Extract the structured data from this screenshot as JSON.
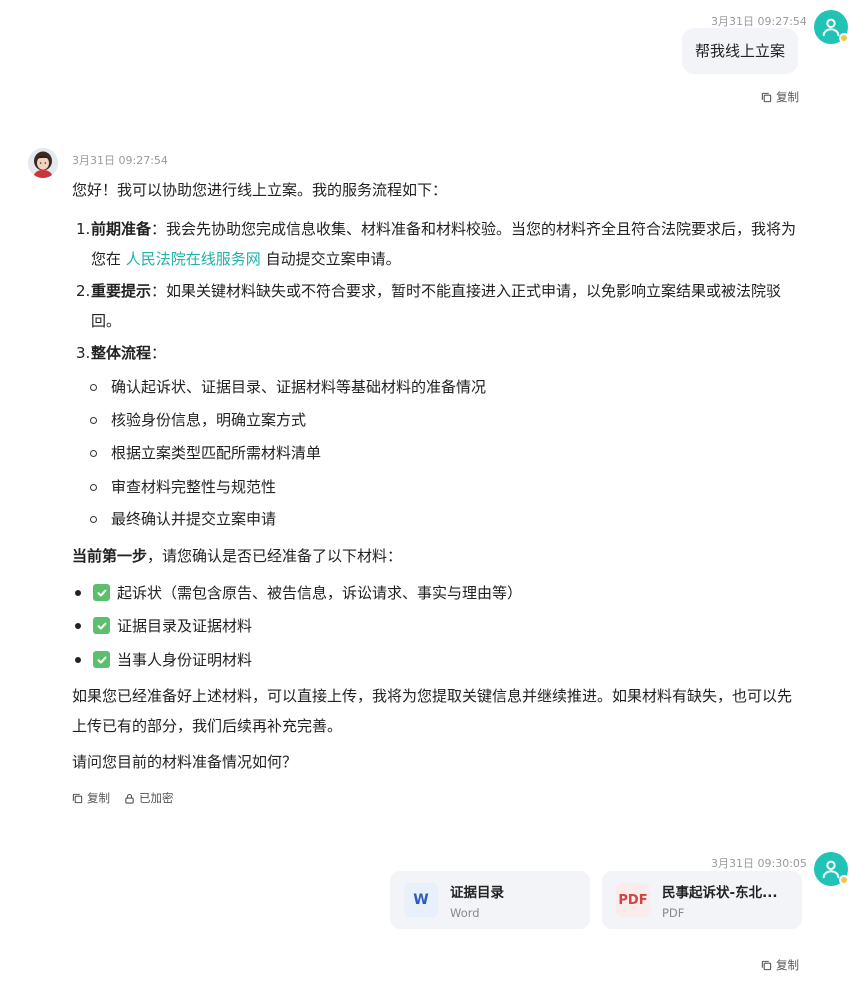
{
  "user_msg_1": {
    "timestamp": "3月31日 09:27:54",
    "text": "帮我线上立案",
    "copy_label": "复制"
  },
  "assistant": {
    "timestamp": "3月31日 09:27:54",
    "intro": "您好！我可以协助您进行线上立案。我的服务流程如下：",
    "items": [
      {
        "num": "1.",
        "title": "前期准备",
        "text_before_link": "：我会先协助您完成信息收集、材料准备和材料校验。当您的材料齐全且符合法院要求后，我将为您在 ",
        "link": "人民法院在线服务网",
        "text_after_link": " 自动提交立案申请。"
      },
      {
        "num": "2.",
        "title": "重要提示",
        "text": "：如果关键材料缺失或不符合要求，暂时不能直接进入正式申请，以免影响立案结果或被法院驳回。"
      },
      {
        "num": "3.",
        "title": "整体流程",
        "text": "：",
        "subitems": [
          "确认起诉状、证据目录、证据材料等基础材料的准备情况",
          "核验身份信息，明确立案方式",
          "根据立案类型匹配所需材料清单",
          "审查材料完整性与规范性",
          "最终确认并提交立案申请"
        ]
      }
    ],
    "step_title": "当前第一步",
    "step_text": "，请您确认是否已经准备了以下材料：",
    "checklist": [
      "起诉状（需包含原告、被告信息，诉讼请求、事实与理由等）",
      "证据目录及证据材料",
      "当事人身份证明材料"
    ],
    "para1": "如果您已经准备好上述材料，可以直接上传，我将为您提取关键信息并继续推进。如果材料有缺失，也可以先上传已有的部分，我们后续再补充完善。",
    "para2": "请问您目前的材料准备情况如何？",
    "copy_label": "复制",
    "encrypted_label": "已加密"
  },
  "user_msg_2": {
    "timestamp": "3月31日 09:30:05",
    "files": [
      {
        "icon": "W",
        "name": "证据目录",
        "type": "Word"
      },
      {
        "icon": "PDF",
        "name": "民事起诉状-东北...",
        "type": "PDF"
      }
    ],
    "copy_label": "复制"
  },
  "colors": {
    "accent": "#1fb3aa",
    "user_avatar": "#21c3b6",
    "check": "#5cbf6b"
  }
}
